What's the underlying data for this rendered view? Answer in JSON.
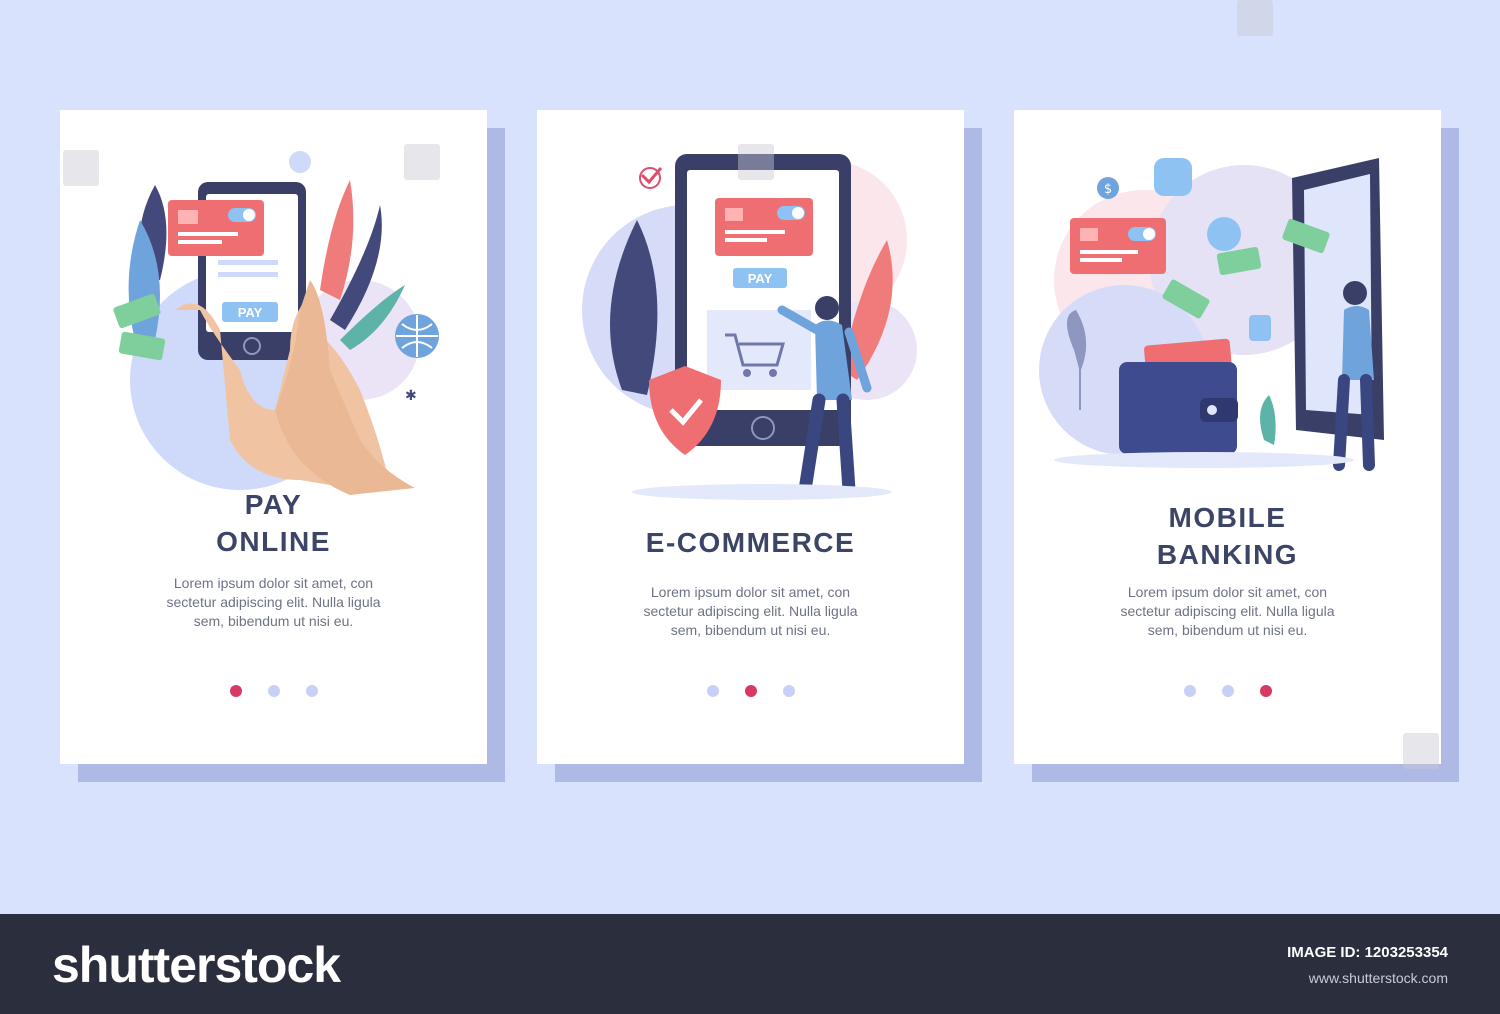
{
  "cards": [
    {
      "title_line1": "PAY",
      "title_line2": "ONLINE",
      "body": [
        "Lorem ipsum dolor sit amet, con",
        "sectetur adipiscing elit. Nulla ligula",
        "sem, bibendum ut nisi eu."
      ],
      "pay_label": "PAY",
      "active_dot": 0
    },
    {
      "title_line1": "E-COMMERCE",
      "title_line2": "",
      "body": [
        "Lorem ipsum dolor sit amet, con",
        "sectetur adipiscing elit. Nulla ligula",
        "sem, bibendum ut nisi eu."
      ],
      "pay_label": "PAY",
      "active_dot": 1
    },
    {
      "title_line1": "MOBILE",
      "title_line2": "BANKING",
      "body": [
        "Lorem ipsum dolor sit amet, con",
        "sectetur adipiscing elit. Nulla ligula",
        "sem, bibendum ut nisi eu."
      ],
      "active_dot": 2
    }
  ],
  "footer": {
    "brand": "shutterstock",
    "image_id": "IMAGE ID: 1203253354",
    "site": "www.shutterstock.com"
  },
  "colors": {
    "accent": "#d63a63",
    "background": "#d9e2fc",
    "card": "#ffffff",
    "title": "#3c4566",
    "dot_inactive": "#c8d1f5",
    "footer": "#2b2f3d"
  }
}
